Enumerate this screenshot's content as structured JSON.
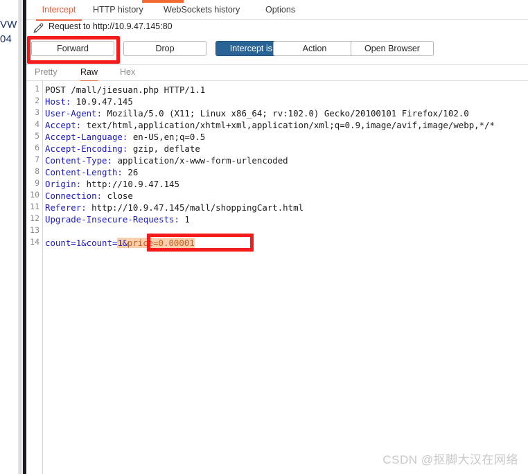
{
  "background_window": {
    "fragment_line_1": "VW",
    "fragment_line_2": "04"
  },
  "tabs": [
    {
      "id": "intercept",
      "label": "Intercept",
      "active": true
    },
    {
      "id": "http-history",
      "label": "HTTP history",
      "active": false
    },
    {
      "id": "websockets",
      "label": "WebSockets history",
      "active": false
    },
    {
      "id": "options",
      "label": "Options",
      "active": false
    }
  ],
  "request_header": {
    "icon": "pencil-icon",
    "title": "Request to http://10.9.47.145:80"
  },
  "buttons": [
    {
      "id": "forward",
      "label": "Forward",
      "style": "default"
    },
    {
      "id": "drop",
      "label": "Drop",
      "style": "default"
    },
    {
      "id": "intercept",
      "label": "Intercept is on",
      "style": "primary"
    },
    {
      "id": "action",
      "label": "Action",
      "style": "default"
    },
    {
      "id": "open-browser",
      "label": "Open Browser",
      "style": "default"
    }
  ],
  "subtabs": [
    {
      "id": "pretty",
      "label": "Pretty",
      "active": false
    },
    {
      "id": "raw",
      "label": "Raw",
      "active": true
    },
    {
      "id": "hex",
      "label": "Hex",
      "active": false
    }
  ],
  "editor": {
    "line_numbers": [
      "1",
      "2",
      "3",
      "4",
      "5",
      "6",
      "7",
      "8",
      "9",
      "10",
      "11",
      "12",
      "13",
      "14"
    ],
    "lines": [
      {
        "n": 1,
        "name": "POST /mall/jiesuan.php HTTP/1.1",
        "value": ""
      },
      {
        "n": 2,
        "name": "Host:",
        "value": " 10.9.47.145"
      },
      {
        "n": 3,
        "name": "User-Agent:",
        "value": " Mozilla/5.0 (X11; Linux x86_64; rv:102.0) Gecko/20100101 Firefox/102.0"
      },
      {
        "n": 4,
        "name": "Accept:",
        "value": " text/html,application/xhtml+xml,application/xml;q=0.9,image/avif,image/webp,*/*"
      },
      {
        "n": 5,
        "name": "Accept-Language:",
        "value": " en-US,en;q=0.5"
      },
      {
        "n": 6,
        "name": "Accept-Encoding:",
        "value": " gzip, deflate"
      },
      {
        "n": 7,
        "name": "Content-Type:",
        "value": " application/x-www-form-urlencoded"
      },
      {
        "n": 8,
        "name": "Content-Length:",
        "value": " 26"
      },
      {
        "n": 9,
        "name": "Origin:",
        "value": " http://10.9.47.145"
      },
      {
        "n": 10,
        "name": "Connection:",
        "value": " close"
      },
      {
        "n": 11,
        "name": "Referer:",
        "value": " http://10.9.47.145/mall/shoppingCart.html"
      },
      {
        "n": 12,
        "name": "Upgrade-Insecure-Requests:",
        "value": " 1"
      },
      {
        "n": 13,
        "name": "",
        "value": ""
      },
      {
        "n": 14,
        "name": "",
        "value": ""
      }
    ],
    "body_line": {
      "prefix": "count=1&count=",
      "selected_prefix": "1&",
      "selected_text": "price=0.00001"
    }
  },
  "annotations": [
    {
      "id": "forward-highlight",
      "color": "#f41b1b",
      "target": "forward-button"
    },
    {
      "id": "price-highlight",
      "color": "#f41b1b",
      "target": "body-price-param"
    }
  ],
  "watermark": {
    "text": "CSDN @抠脚大汉在网络"
  },
  "colors": {
    "accent_orange": "#e8603c",
    "primary_blue": "#2a6496",
    "annotation_red": "#f41b1b",
    "header_name_blue": "#1a19c4",
    "selection_bg": "#f9cfae",
    "selection_fg": "#c8601b"
  }
}
